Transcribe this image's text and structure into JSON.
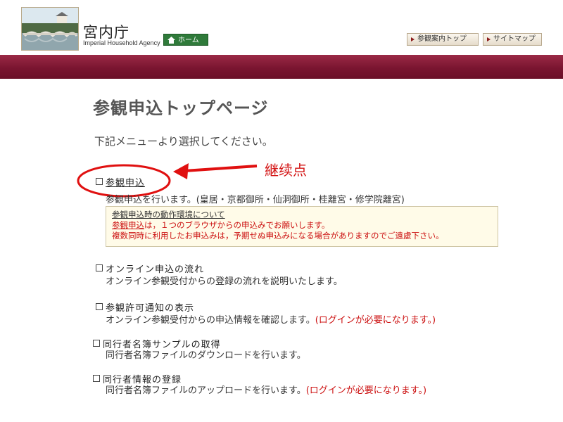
{
  "header": {
    "logo_title": "宮内庁",
    "logo_subtitle": "Imperial Household Agency",
    "home_label": "ホーム",
    "nav": [
      {
        "label": "参観案内トップ"
      },
      {
        "label": "サイトマップ"
      }
    ]
  },
  "main": {
    "page_title": "参観申込トップページ",
    "intro": "下記メニューより選択してください。",
    "annotation": "継续点",
    "items": [
      {
        "title": "参観申込",
        "desc": "参観申込を行います。(皇居・京都御所・仙洞御所・桂離宮・修学院離宮)",
        "note": ""
      },
      {
        "title": "オンライン申込の流れ",
        "desc": "オンライン参観受付からの登録の流れを説明いたします。",
        "note": ""
      },
      {
        "title": "参観許可通知の表示",
        "desc": "オンライン参観受付からの申込情報を確認します。",
        "note": "(ログインが必要になります。)"
      },
      {
        "title": "同行者名簿サンプルの取得",
        "desc": "同行者名簿ファイルのダウンロードを行います。",
        "note": ""
      },
      {
        "title": "同行者情報の登録",
        "desc": "同行者名簿ファイルのアップロードを行います。",
        "note": "(ログインが必要になります。)"
      }
    ],
    "notice": {
      "title": "参観申込時の動作環境について",
      "line1_prefix": "参観申込",
      "line1_rest": "は，１つのブラウザからの申込みでお願いします。",
      "line2": "複数同時に利用したお申込みは，予期せぬ申込みになる場合がありますのでご遠慮下さい。"
    }
  },
  "colors": {
    "band": "#7a1530",
    "home_button": "#2f7a3a",
    "annotation": "#d31414",
    "note": "#cc1111"
  }
}
